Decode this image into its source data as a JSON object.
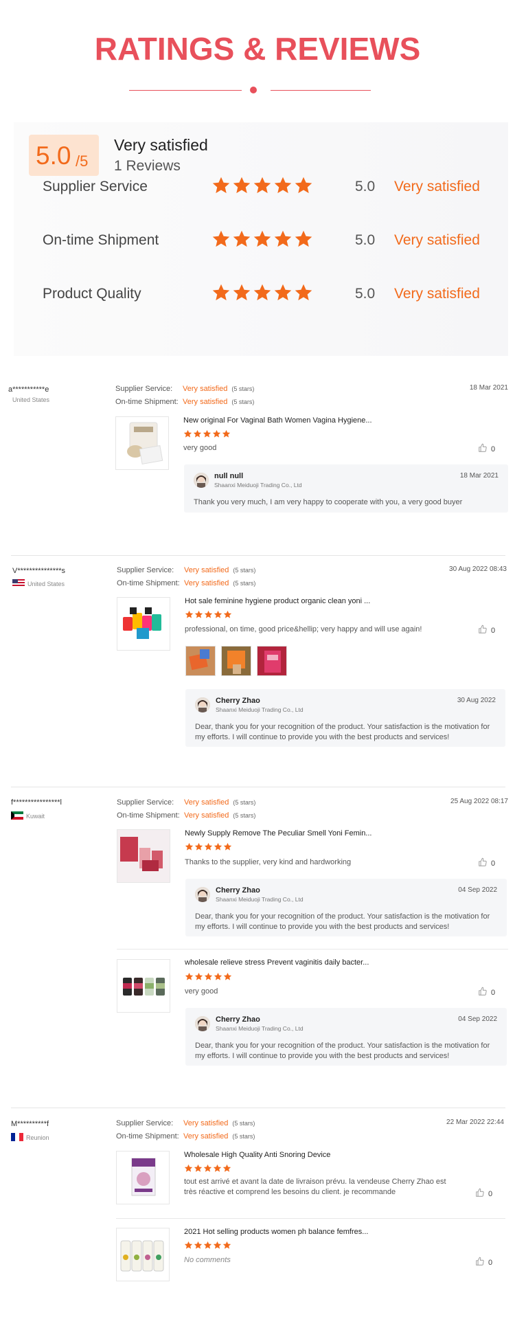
{
  "header": {
    "title": "RATINGS & REVIEWS"
  },
  "summary": {
    "score": "5.0",
    "score_max": "/5",
    "verdict": "Very satisfied",
    "review_count": "1 Reviews",
    "metrics": [
      {
        "label": "Supplier Service",
        "value": "5.0",
        "verdict": "Very satisfied",
        "stars": 5
      },
      {
        "label": "On-time Shipment",
        "value": "5.0",
        "verdict": "Very satisfied",
        "stars": 5
      },
      {
        "label": "Product Quality",
        "value": "5.0",
        "verdict": "Very satisfied",
        "stars": 5
      }
    ]
  },
  "colors": {
    "accent": "#e8505b",
    "star": "#f26a1b",
    "score_bg": "#fde3d0"
  },
  "labels": {
    "supplier_service": "Supplier Service:",
    "ontime_shipment": "On-time Shipment:",
    "stars_note": "(5 stars)",
    "rating_value": "Very satisfied"
  },
  "reviews": [
    {
      "name": "a***********e",
      "country": "United States",
      "date": "18 Mar 2021",
      "items": [
        {
          "title": "New original For Vaginal Bath Women Vagina Hygiene...",
          "text": "very good",
          "likes": "0",
          "reply": {
            "name": "null null",
            "company": "Shaanxi Meiduoji Trading Co., Ltd",
            "date": "18 Mar 2021",
            "text": "Thank you very much, I am very happy to cooperate with you, a very good buyer"
          }
        }
      ]
    },
    {
      "name": "V***************s",
      "country": "United States",
      "date": "30 Aug 2022 08:43",
      "items": [
        {
          "title": "Hot sale feminine hygiene product organic clean yoni ...",
          "text": "professional, on time, good price&hellip; very happy and will use again!",
          "likes": "0",
          "reply": {
            "name": "Cherry Zhao",
            "company": "Shaanxi Meiduoji Trading Co., Ltd",
            "date": "30 Aug 2022",
            "text": "Dear, thank you for your recognition of the product. Your satisfaction is the motivation for my efforts. I will continue to provide you with the best products and services!"
          }
        }
      ]
    },
    {
      "name": "f****************l",
      "country": "Kuwait",
      "date": "25 Aug 2022 08:17",
      "items": [
        {
          "title": "Newly Supply Remove The Peculiar Smell Yoni Femin...",
          "text": "Thanks to the supplier, very kind and hardworking",
          "likes": "0",
          "reply": {
            "name": "Cherry Zhao",
            "company": "Shaanxi Meiduoji Trading Co., Ltd",
            "date": "04 Sep 2022",
            "text": "Dear, thank you for your recognition of the product. Your satisfaction is the motivation for my efforts. I will continue to provide you with the best products and services!"
          }
        },
        {
          "title": "wholesale relieve stress Prevent vaginitis daily bacter...",
          "text": "very good",
          "likes": "0",
          "reply": {
            "name": "Cherry Zhao",
            "company": "Shaanxi Meiduoji Trading Co., Ltd",
            "date": "04 Sep 2022",
            "text": "Dear, thank you for your recognition of the product. Your satisfaction is the motivation for my efforts. I will continue to provide you with the best products and services!"
          }
        }
      ]
    },
    {
      "name": "M**********f",
      "country": "Reunion",
      "date": "22 Mar 2022 22:44",
      "items": [
        {
          "title": "Wholesale High Quality Anti Snoring Device",
          "text": "tout est arrivé et avant la date de livraison prévu. la vendeuse Cherry Zhao est très réactive et comprend les besoins du client. je recommande",
          "likes": "0"
        },
        {
          "title": "2021 Hot selling products women ph balance femfres...",
          "text": "No comments",
          "likes": "0"
        }
      ]
    }
  ]
}
